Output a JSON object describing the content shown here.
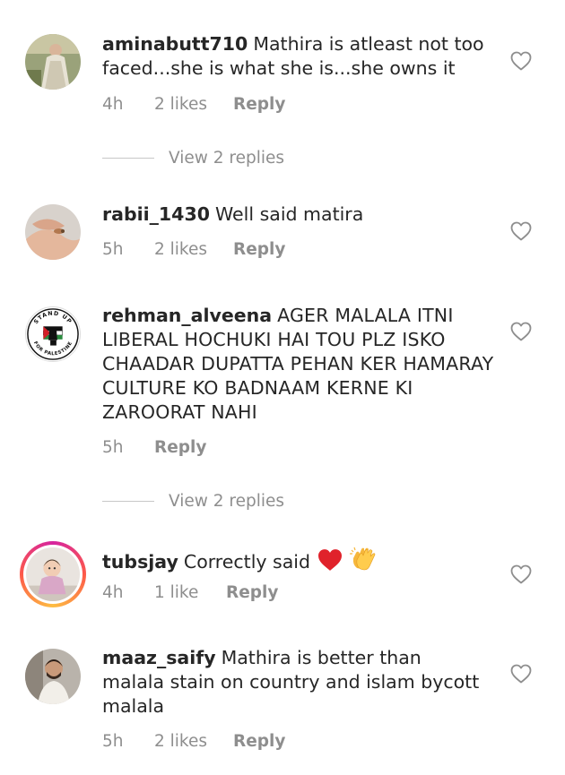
{
  "comments": [
    {
      "username": "aminabutt710",
      "text": "Mathira is atleast not too faced...she is what she is...she owns it",
      "time": "4h",
      "likes": "2 likes",
      "reply": "Reply",
      "replies_link": "View 2 replies"
    },
    {
      "username": "rabii_1430",
      "text": "Well said matira",
      "time": "5h",
      "likes": "2 likes",
      "reply": "Reply"
    },
    {
      "username": "rehman_alveena",
      "text": "AGER MALALA ITNI LIBERAL HOCHUKI HAI TOU PLZ ISKO CHAADAR DUPATTA PEHAN KER HAMARAY CULTURE KO BADNAAM KERNE KI ZAROORAT NAHI",
      "time": "5h",
      "reply": "Reply",
      "replies_link": "View 2 replies",
      "avatar_text_top": "STAND UP",
      "avatar_text_bottom": "FOR PALESTINE"
    },
    {
      "username": "tubsjay",
      "text": "Correctly said",
      "time": "4h",
      "likes": "1 like",
      "reply": "Reply"
    },
    {
      "username": "maaz_saify",
      "text": "Mathira is better than malala stain on country and islam bycott malala",
      "time": "5h",
      "likes": "2 likes",
      "reply": "Reply"
    }
  ],
  "colors": {
    "text": "#262626",
    "secondary": "#8e8e8e",
    "heart_outline": "#8e8e8e",
    "story_ring": "#d6249f"
  },
  "icons": {
    "like": "heart-outline-icon",
    "emoji_1": "red-heart-emoji",
    "emoji_2": "clapping-hands-emoji"
  }
}
